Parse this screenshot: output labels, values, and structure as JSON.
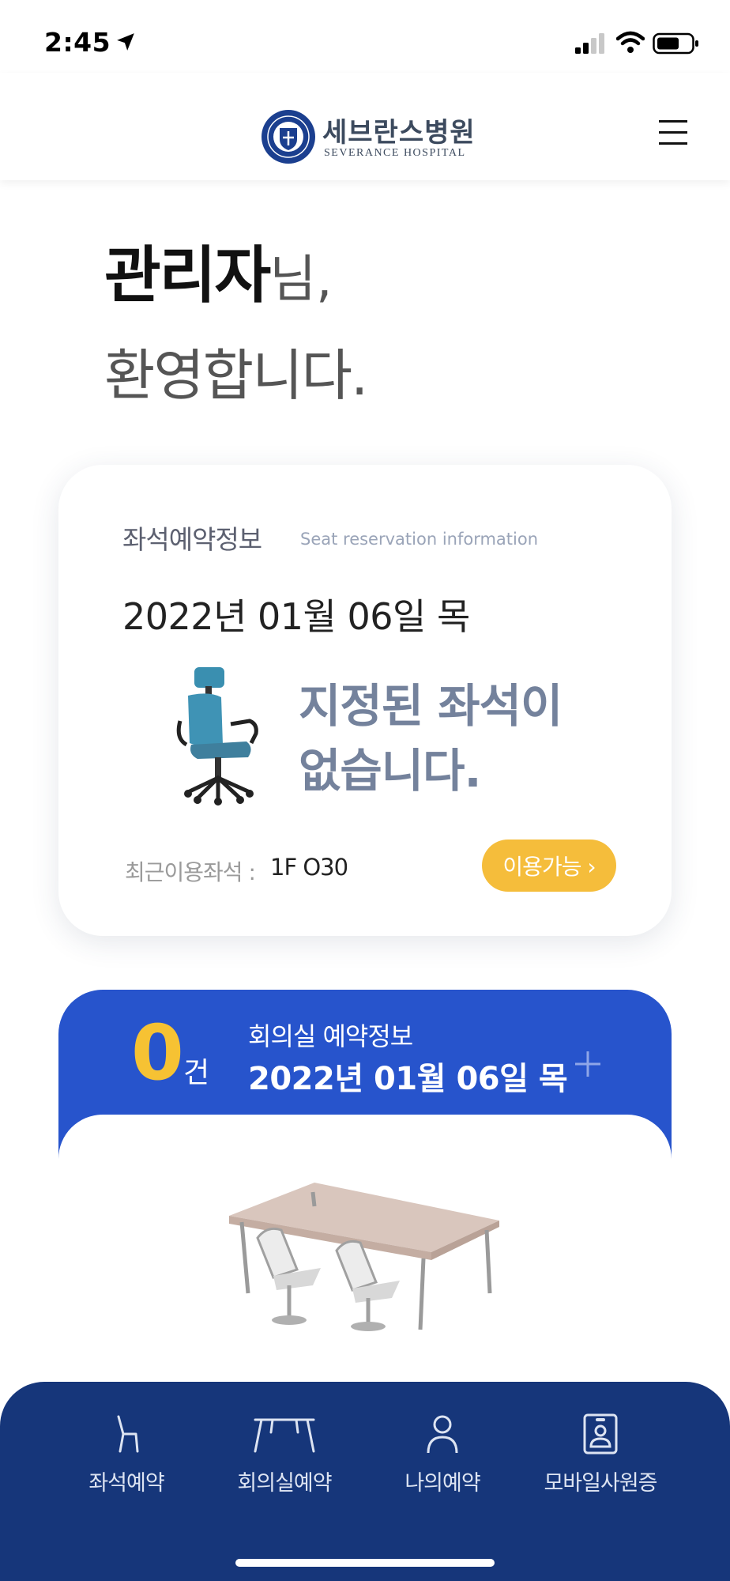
{
  "status_bar": {
    "time": "2:45"
  },
  "header": {
    "logo_korean": "세브란스병원",
    "logo_english": "SEVERANCE HOSPITAL",
    "menu_icon": "hamburger-menu-icon"
  },
  "greeting": {
    "name": "관리자",
    "honorific": "님,",
    "welcome": "환영합니다."
  },
  "seat_card": {
    "title": "좌석예약정보",
    "title_en": "Seat reservation information",
    "date": "2022년 01월 06일 목",
    "message_line1": "지정된 좌석이",
    "message_line2": "없습니다.",
    "recent_label": "최근이용좌석 :",
    "recent_value": "1F O30",
    "available_button": "이용가능 ›",
    "accent_color": "#f5bd3b",
    "message_color": "#74829c"
  },
  "meeting_card": {
    "count": "0",
    "count_unit": "건",
    "title": "회의실 예약정보",
    "date": "2022년 01월 06일 목",
    "add_icon": "plus-icon",
    "background_color": "#2754cc"
  },
  "bottom_nav": {
    "background_color": "#16367a",
    "items": [
      {
        "label": "좌석예약",
        "icon": "chair-icon"
      },
      {
        "label": "회의실예약",
        "icon": "table-icon"
      },
      {
        "label": "나의예약",
        "icon": "person-icon"
      },
      {
        "label": "모바일사원증",
        "icon": "id-badge-icon"
      }
    ]
  }
}
